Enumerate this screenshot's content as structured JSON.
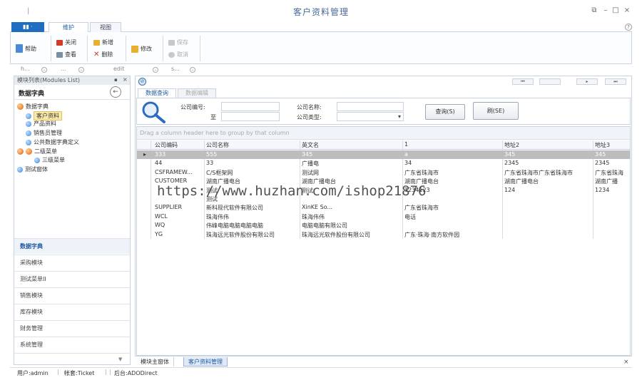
{
  "window": {
    "title": "客户资料管理",
    "qat": "|",
    "controls": {
      "restore": "⧉",
      "minimize": "–",
      "maximize": "□",
      "close": "×"
    }
  },
  "ribbon": {
    "file_tab": "▮▮ ·",
    "tabs": [
      "维护",
      "视图"
    ],
    "help_icon": "?",
    "buttons": {
      "help": "帮助",
      "close": "关闭",
      "view": "查看",
      "add": "新增",
      "delete": "删除",
      "edit": "修改",
      "save": "保存",
      "cancel": "取消"
    },
    "group_labels": [
      "h...",
      "...",
      "edit",
      "s..."
    ]
  },
  "left_panel": {
    "header": "模块列表(Modules List)",
    "pin": "▪",
    "close": "×",
    "title": "数据字典",
    "back_icon": "←",
    "tree": [
      {
        "label": "数据字典",
        "kind": "orb",
        "indent": 0
      },
      {
        "label": "客户资料",
        "kind": "ball",
        "indent": 1,
        "selected": true
      },
      {
        "label": "产品资料",
        "kind": "ball",
        "indent": 1
      },
      {
        "label": "销售员管理",
        "kind": "ball",
        "indent": 1
      },
      {
        "label": "公共数据字典定义",
        "kind": "ball",
        "indent": 1
      },
      {
        "label": "二级菜单",
        "kind": "orb2",
        "indent": 0
      },
      {
        "label": "三级菜单",
        "kind": "ball",
        "indent": 2
      },
      {
        "label": "测试窗体",
        "kind": "ball",
        "indent": 0
      }
    ],
    "nav": [
      "数据字典",
      "采购模块",
      "测试菜单II",
      "销售模块",
      "库存模块",
      "财务管理",
      "系统管理"
    ],
    "nav_active": 0,
    "nav_down": "▼"
  },
  "main": {
    "header_icon": "⊘",
    "subtabs": [
      "数据查询",
      "数据编辑"
    ],
    "nav_buttons": [
      "⏮",
      "",
      "▸",
      "⏭"
    ],
    "search": {
      "label_code": "公司编号:",
      "label_to": "至",
      "label_name": "公司名称:",
      "label_type": "公司类型:",
      "type_arrow": "▾",
      "query_button": "查询(S)",
      "second_button": "刷(SE)"
    },
    "grid": {
      "groupbar": "Drag a column header here to group by that column",
      "row_indicator": "▸",
      "columns": [
        "公司编码",
        "公司名称",
        "英文名",
        "1",
        "地址2",
        "地址3"
      ],
      "rows": [
        [
          "333",
          "555",
          "345",
          "a",
          "345",
          "345"
        ],
        [
          "44",
          "33",
          "广播电",
          "34",
          "2345",
          "2345"
        ],
        [
          "CSFRAMEW...",
          "C/S框架网",
          "测试网",
          "广东省珠海市",
          "广东省珠海市广东省珠海市",
          "广东省珠海"
        ],
        [
          "CUSTOMER",
          "湖南广播电台",
          "湖南广播电台",
          "湖南广播电台",
          "湖南广播电台",
          "湖南广播"
        ],
        [
          "",
          "测试",
          "测试",
          "1234123",
          "124",
          "1234"
        ],
        [
          "",
          "测试",
          "",
          "",
          "",
          ""
        ],
        [
          "SUPPLIER",
          "新科现代软件有限公司",
          "XinKE So...",
          "广东省珠海市",
          "",
          ""
        ],
        [
          "WCL",
          "珠海伟伟",
          "珠海伟伟",
          "电话",
          "",
          ""
        ],
        [
          "WQ",
          "伟峰电脑电脑电脑电脑",
          "电脑电脑有限公司",
          "",
          "",
          ""
        ],
        [
          "YG",
          "珠海远光软件股份有限公司",
          "珠海远光软件股份有限公司",
          "广东·珠海·南方软件园",
          "",
          ""
        ]
      ]
    }
  },
  "watermark": "https://www.huzhan.com/ishop21876",
  "bottom_tabs": [
    "模块主窗体",
    "客户资料管理"
  ],
  "bottom_close": "×",
  "status": {
    "user": "用户:admin",
    "account": "帐套:Ticket",
    "backend": "后台:ADODirect",
    "sep": "|"
  }
}
